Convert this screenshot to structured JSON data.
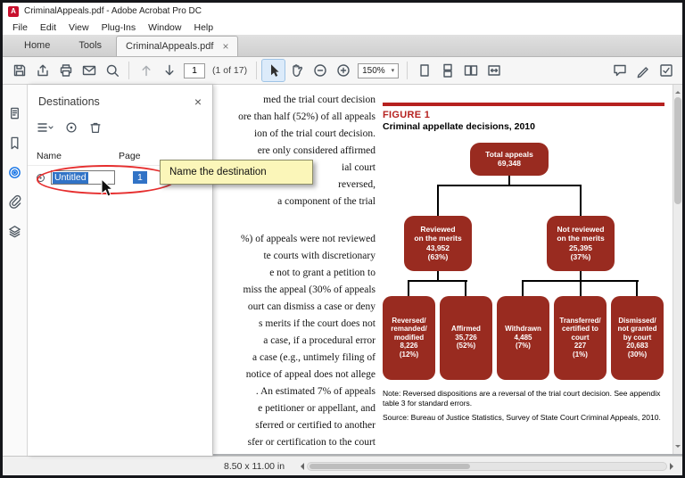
{
  "colors": {
    "selection_blue": "#3173c6",
    "rail_active_blue": "#1473e6",
    "box_red": "#992b20",
    "heading_red": "#b6211f",
    "annotation_red": "#e62e2e",
    "tooltip_bg": "#fbf6b9"
  },
  "icons": {
    "close_glyph": "×",
    "caret_down": "▾",
    "acrobat_logo": "A"
  },
  "window": {
    "title": "CriminalAppeals.pdf - Adobe Acrobat Pro DC",
    "menu_items": [
      "File",
      "Edit",
      "View",
      "Plug-Ins",
      "Window",
      "Help"
    ],
    "tab_items": [
      "Home",
      "Tools",
      "CriminalAppeals.pdf"
    ]
  },
  "toolbar": {
    "page_value": "1",
    "page_count": "(1 of 17)",
    "zoom_value": "150%"
  },
  "panel": {
    "title": "Destinations",
    "col_name": "Name",
    "col_page": "Page",
    "row_name": "Untitled",
    "row_page": "1"
  },
  "callout": {
    "tooltip": "Name the destination"
  },
  "doc": {
    "para1": [
      "med the trial court decision",
      "ore than half (52%) of all appeals",
      "ion of the trial court decision.",
      "ere only considered affirmed",
      "ial court",
      "reversed,",
      "a component of the trial"
    ],
    "para2": [
      "%) of appeals were not reviewed",
      "te courts with discretionary",
      "e not to grant a petition to",
      "miss the appeal (30% of appeals",
      "ourt can dismiss a case or deny",
      "s merits if the court does not",
      "a case, if a procedural error",
      "a case (e.g., untimely filing of",
      "notice of appeal does not allege",
      ". An estimated 7% of appeals",
      "e petitioner or appellant, and",
      "sferred or certified to another",
      "sfer or certification to the court"
    ],
    "figure": {
      "label": "FIGURE 1",
      "title": "Criminal appellate decisions, 2010",
      "note": "Note: Reversed dispositions are a reversal of the trial court decision. See appendix table 3 for standard errors.",
      "source": "Source: Bureau of Justice Statistics, Survey of State Court Criminal Appeals, 2010."
    }
  },
  "chart_data": {
    "type": "flowchart",
    "title": "Criminal appellate decisions, 2010",
    "nodes": [
      {
        "id": "total",
        "parent": null,
        "name": "Total appeals",
        "display": "Total appeals",
        "value": "69,348",
        "n": 69348,
        "pct": ""
      },
      {
        "id": "reviewed",
        "parent": "total",
        "name": "Reviewed on the merits",
        "display": "Reviewed\non the merits",
        "value": "43,952",
        "n": 43952,
        "pct": "(63%)"
      },
      {
        "id": "not-reviewed",
        "parent": "total",
        "name": "Not reviewed on the merits",
        "display": "Not reviewed\non the merits",
        "value": "25,395",
        "n": 25395,
        "pct": "(37%)"
      },
      {
        "id": "reversed",
        "parent": "reviewed",
        "name": "Reversed/remanded/modified",
        "display": "Reversed/\nremanded/\nmodified",
        "value": "8,226",
        "n": 8226,
        "pct": "(12%)"
      },
      {
        "id": "affirmed",
        "parent": "reviewed",
        "name": "Affirmed",
        "display": "Affirmed",
        "value": "35,726",
        "n": 35726,
        "pct": "(52%)"
      },
      {
        "id": "withdrawn",
        "parent": "not-reviewed",
        "name": "Withdrawn",
        "display": "Withdrawn",
        "value": "4,485",
        "n": 4485,
        "pct": "(7%)"
      },
      {
        "id": "transferred",
        "parent": "not-reviewed",
        "name": "Transferred/certified to court",
        "display": "Transferred/\ncertified to\ncourt",
        "value": "227",
        "n": 227,
        "pct": "(1%)"
      },
      {
        "id": "dismissed",
        "parent": "not-reviewed",
        "name": "Dismissed/not granted by court",
        "display": "Dismissed/\nnot granted\nby court",
        "value": "20,683",
        "n": 20683,
        "pct": "(30%)"
      }
    ]
  },
  "status": {
    "page_size": "8.50 x 11.00 in"
  }
}
